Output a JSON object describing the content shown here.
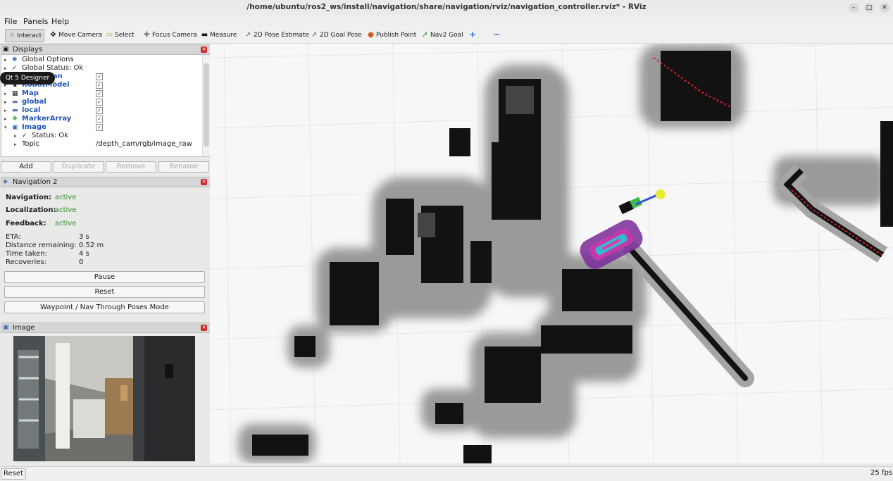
{
  "window": {
    "title": "/home/ubuntu/ros2_ws/install/navigation/share/navigation/rviz/navigation_controller.rviz* - RViz",
    "min_label": "–",
    "max_label": "□",
    "close_label": "✕"
  },
  "menu": {
    "file": "File",
    "panels": "Panels",
    "help": "Help"
  },
  "toolbar": {
    "interact": "Interact",
    "move_camera": "Move Camera",
    "select": "Select",
    "focus_camera": "Focus Camera",
    "measure": "Measure",
    "pose_estimate": "2D Pose Estimate",
    "goal_pose": "2D Goal Pose",
    "publish_point": "Publish Point",
    "nav2_goal": "Nav2 Goal",
    "plus": "+",
    "minus": "−",
    "accent": "#2a8c2a"
  },
  "displays": {
    "title": "Displays",
    "tooltip": "Qt 5 Designer",
    "items": [
      {
        "label": "Global Options",
        "icon": "gear-icon"
      },
      {
        "label": "Global Status: Ok",
        "icon": "check-icon"
      },
      {
        "label": "LaserScan",
        "icon": "laser-icon",
        "checked": "✓"
      },
      {
        "label": "RobotModel",
        "icon": "robot-icon",
        "checked": "✓"
      },
      {
        "label": "Map",
        "icon": "map-icon",
        "checked": "✓"
      },
      {
        "label": "global",
        "icon": "folder-icon",
        "checked": "✓"
      },
      {
        "label": "local",
        "icon": "folder-icon",
        "checked": "✓"
      },
      {
        "label": "MarkerArray",
        "icon": "marker-icon",
        "checked": "✓"
      },
      {
        "label": "Image",
        "icon": "image-icon",
        "checked": "✓"
      },
      {
        "label": "Status: Ok",
        "icon": "check-icon"
      },
      {
        "label": "Topic",
        "value": "/depth_cam/rgb/image_raw"
      }
    ],
    "buttons": {
      "add": "Add",
      "duplicate": "Duplicate",
      "remove": "Remove",
      "rename": "Rename"
    }
  },
  "navigation": {
    "title": "Navigation 2",
    "status": [
      {
        "label": "Navigation:",
        "value": "active"
      },
      {
        "label": "Localization:",
        "value": "active"
      },
      {
        "label": "Feedback:",
        "value": "active"
      }
    ],
    "metrics": [
      {
        "label": "ETA:",
        "value": "3 s"
      },
      {
        "label": "Distance remaining:",
        "value": "0.52 m"
      },
      {
        "label": "Time taken:",
        "value": "4 s"
      },
      {
        "label": "Recoveries:",
        "value": "0"
      }
    ],
    "pause": "Pause",
    "reset": "Reset",
    "waypoint": "Waypoint / Nav Through Poses Mode"
  },
  "image_panel": {
    "title": "Image"
  },
  "status_bar": {
    "reset": "Reset",
    "fps": "25 fps"
  }
}
